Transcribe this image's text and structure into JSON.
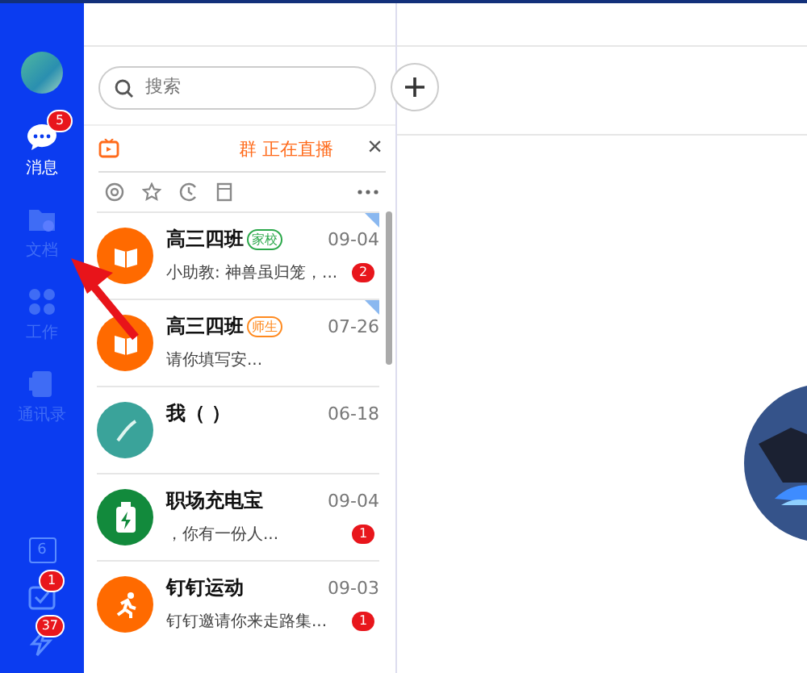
{
  "sidebar": {
    "items": [
      {
        "kind": "chat",
        "label": "消息",
        "badge": "5",
        "selected": true
      },
      {
        "kind": "docs",
        "label": "文档",
        "selected": false
      },
      {
        "kind": "work",
        "label": "工作",
        "selected": false
      },
      {
        "kind": "contacts",
        "label": "通讯录",
        "selected": false
      }
    ],
    "bottom_items": [
      {
        "kind": "calendar",
        "text": "6"
      },
      {
        "kind": "todo",
        "badge": "1"
      },
      {
        "kind": "bolt",
        "badge": "37"
      }
    ]
  },
  "search": {
    "placeholder": "搜索"
  },
  "live_banner": {
    "text": "群 正在直播",
    "close": "×"
  },
  "chats": [
    {
      "kind": "class",
      "name": "高三四班",
      "tag": "家校",
      "color": "#2ba84a",
      "time": "09-04",
      "preview": "小助教: 神兽虽归笼，...",
      "unread": "2",
      "pinned": true
    },
    {
      "kind": "class",
      "name": "高三四班",
      "tag": "师生",
      "color": "#ff8a1f",
      "time": "07-26",
      "preview": "请你填写安...",
      "pinned": true
    },
    {
      "kind": "self",
      "name": "我（        ）",
      "time": "06-18",
      "pinned": false
    },
    {
      "kind": "battery",
      "name": "职场充电宝",
      "time": "09-04",
      "preview": "，你有一份人...",
      "unread": "1",
      "pinned": false
    },
    {
      "kind": "sport",
      "name": "钉钉运动",
      "time": "09-03",
      "preview": "钉钉邀请你来走路集...",
      "unread": "1",
      "pinned": false
    }
  ]
}
